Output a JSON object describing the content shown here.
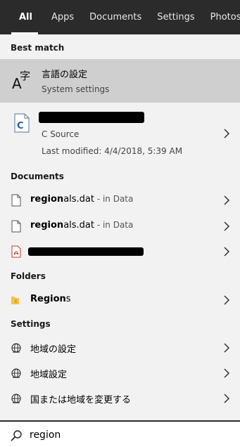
{
  "tabs": [
    {
      "label": "All",
      "active": true
    },
    {
      "label": "Apps"
    },
    {
      "label": "Documents"
    },
    {
      "label": "Settings"
    },
    {
      "label": "Photos"
    }
  ],
  "best_match": {
    "heading": "Best match",
    "title": "言語の設定",
    "subtitle": "System settings",
    "icon": "language-icon",
    "icon_letters": {
      "big": "A",
      "small": "字"
    }
  },
  "c_source": {
    "icon": "c-source-file-icon",
    "icon_letter": "C",
    "type": "C Source",
    "modified": "Last modified: 4/4/2018, 5:39 AM"
  },
  "documents": {
    "heading": "Documents",
    "items": [
      {
        "match": "region",
        "rest": "als.dat",
        "location": " - in Data",
        "icon": "file-icon"
      },
      {
        "match": "region",
        "rest": "als.dat",
        "location": " - in Data",
        "icon": "file-icon"
      },
      {
        "icon": "pdf-icon",
        "redacted": true
      }
    ]
  },
  "folders": {
    "heading": "Folders",
    "items": [
      {
        "match": "Region",
        "rest": "s",
        "icon": "folder-icon"
      }
    ]
  },
  "settings": {
    "heading": "Settings",
    "items": [
      {
        "label": "地域の設定",
        "icon": "globe-icon"
      },
      {
        "label": "地域設定",
        "icon": "globe-icon"
      },
      {
        "label": "国または地域を変更する",
        "icon": "globe-icon"
      }
    ]
  },
  "search": {
    "value": "region",
    "icon": "search-icon"
  },
  "colors": {
    "tabbar": "#2b2b2b",
    "selected_bg": "#cfcfcf",
    "panel_bg": "#f2f2f2"
  }
}
